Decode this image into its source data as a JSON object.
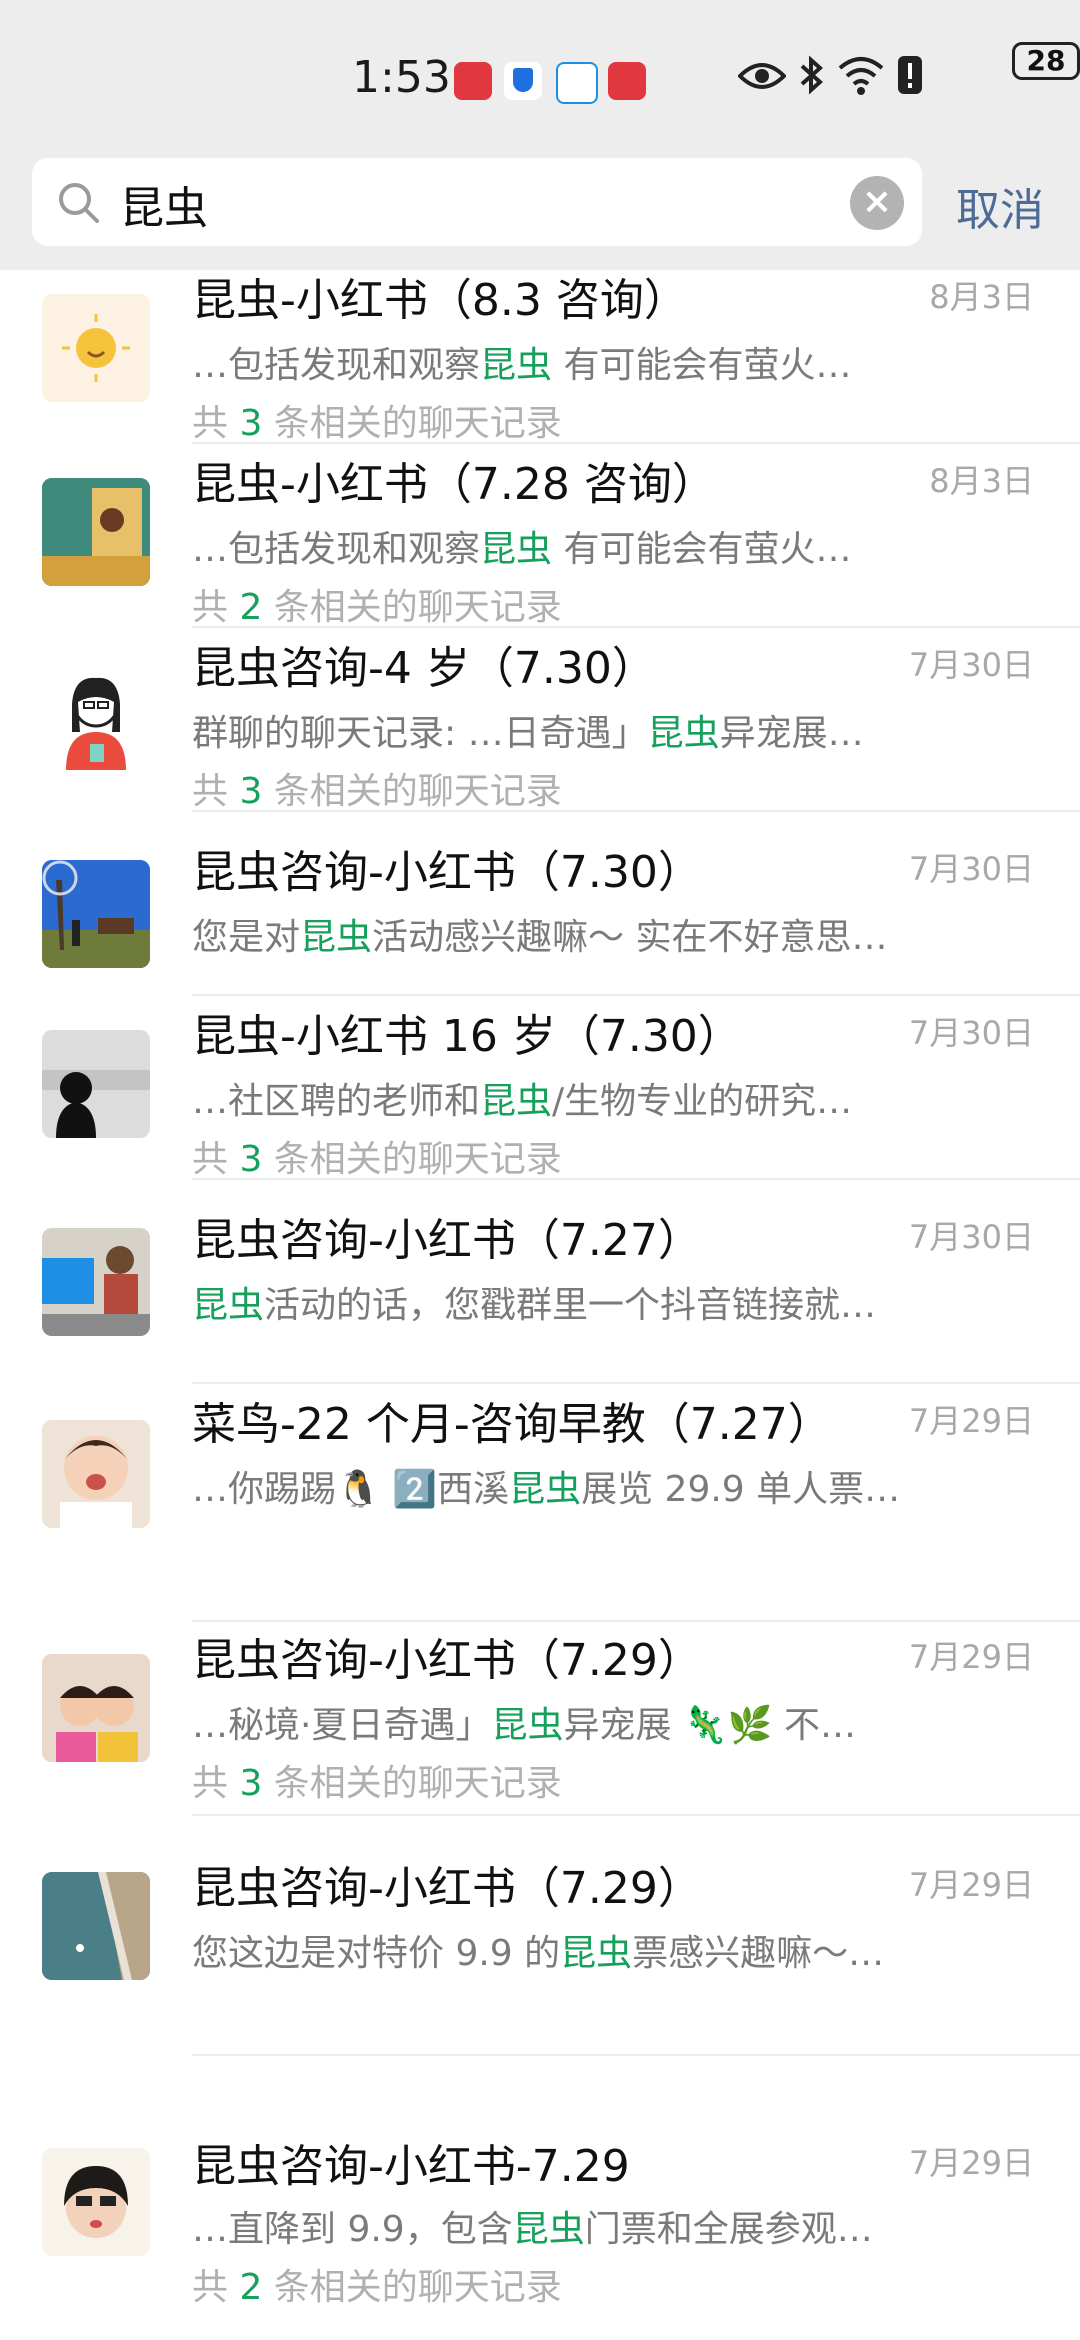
{
  "status_bar": {
    "time": "1:53",
    "battery": "28"
  },
  "search": {
    "query": "昆虫",
    "cancel_label": "取消"
  },
  "results": [
    {
      "title": "昆虫-小红书（8.3 咨询）",
      "date": "8月3日",
      "pre": "…包括发现和观察",
      "kw": "昆虫",
      "post": " 有可能会有萤火…",
      "count_pre": "共 ",
      "count": "3",
      "count_post": " 条相关的聊天记录"
    },
    {
      "title": "昆虫-小红书（7.28 咨询）",
      "date": "8月3日",
      "pre": "…包括发现和观察",
      "kw": "昆虫",
      "post": " 有可能会有萤火…",
      "count_pre": "共 ",
      "count": "2",
      "count_post": " 条相关的聊天记录"
    },
    {
      "title": "昆虫咨询-4 岁（7.30）",
      "date": "7月30日",
      "pre": "群聊的聊天记录: …日奇遇」",
      "kw": "昆虫",
      "post": "异宠展…",
      "count_pre": "共 ",
      "count": "3",
      "count_post": " 条相关的聊天记录"
    },
    {
      "title": "昆虫咨询-小红书（7.30）",
      "date": "7月30日",
      "pre": "您是对",
      "kw": "昆虫",
      "post": "活动感兴趣嘛～ 实在不好意思…"
    },
    {
      "title": "昆虫-小红书 16 岁（7.30）",
      "date": "7月30日",
      "pre": "…社区聘的老师和",
      "kw": "昆虫",
      "post": "/生物专业的研究…",
      "count_pre": "共 ",
      "count": "3",
      "count_post": " 条相关的聊天记录"
    },
    {
      "title": "昆虫咨询-小红书（7.27）",
      "date": "7月30日",
      "pre": "",
      "kw": "昆虫",
      "post": "活动的话，您戳群里一个抖音链接就…"
    },
    {
      "title": "菜鸟-22 个月-咨询早教（7.27）",
      "date": "7月29日",
      "pre": "…你踢踢🐧 2️⃣西溪",
      "kw": "昆虫",
      "post": "展览 29.9 单人票…"
    },
    {
      "title": "昆虫咨询-小红书（7.29）",
      "date": "7月29日",
      "pre": "…秘境·夏日奇遇」",
      "kw": "昆虫",
      "post": "异宠展 🦎🌿 不…",
      "count_pre": "共 ",
      "count": "3",
      "count_post": " 条相关的聊天记录"
    },
    {
      "title": "昆虫咨询-小红书（7.29）",
      "date": "7月29日",
      "pre": "您这边是对特价 9.9 的",
      "kw": "昆虫",
      "post": "票感兴趣嘛～…"
    },
    {
      "title": "昆虫咨询-小红书-7.29",
      "date": "7月29日",
      "pre": "…直降到 9.9，包含",
      "kw": "昆虫",
      "post": "门票和全展参观…",
      "count_pre": "共 ",
      "count": "2",
      "count_post": " 条相关的聊天记录"
    }
  ],
  "colors": {
    "highlight": "#16a05b",
    "header_bg": "#ededed",
    "cancel": "#4e6a97"
  }
}
